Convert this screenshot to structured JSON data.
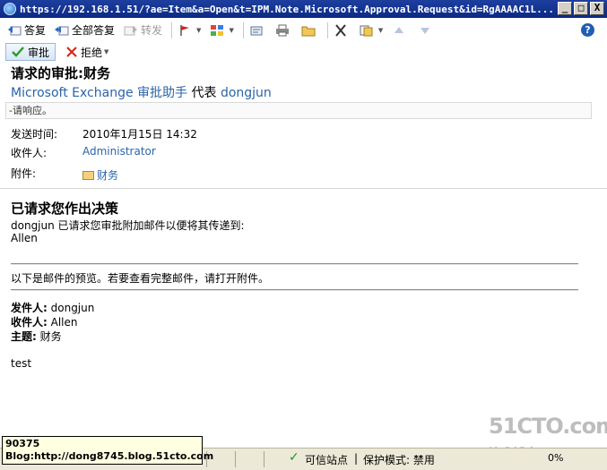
{
  "window": {
    "title": "https://192.168.1.51/?ae=Item&a=Open&t=IPM.Note.Microsoft.Approval.Request&id=RgAAAAC1L...",
    "buttons": [
      "_",
      "□",
      "X"
    ]
  },
  "toolbar": {
    "reply_label": "答复",
    "reply_all_label": "全部答复",
    "forward_label": "转发",
    "help_label": "?"
  },
  "actions": {
    "approve_label": "审批",
    "reject_label": "拒绝"
  },
  "message": {
    "subject": "请求的审批:财务",
    "sender_app": "Microsoft Exchange 审批助手",
    "on_behalf_word": "代表",
    "sender_user": "dongjun",
    "respond_prompt": "-请响应。",
    "headers": {
      "sent_label": "发送时间:",
      "sent_value": "2010年1月15日 14:32",
      "to_label": "收件人:",
      "to_value": "Administrator",
      "attachment_label": "附件:",
      "attachment_value": "财务"
    }
  },
  "body": {
    "heading": "已请求您作出决策",
    "line1": "dongjun 已请求您审批附加邮件以便将其传递到:",
    "line2": "Allen",
    "preview_note": "以下是邮件的预览。若要查看完整邮件，请打开附件。",
    "from_label": "发件人:",
    "from_value": " dongjun",
    "to_label": "收件人:",
    "to_value": " Allen",
    "subject_label": "主题:",
    "subject_value": " 财务",
    "content": "test"
  },
  "statusbar": {
    "zone": "可信站点",
    "separator": "|",
    "protected_mode": "保护模式: 禁用",
    "zoom": "0%"
  },
  "tooltip": {
    "line1": "90375",
    "line2": "Blog:http://dong8745.blog.51cto.com"
  },
  "watermark": {
    "brand": "51CTO.com",
    "tagline": "技术博客 Blog"
  },
  "colors": {
    "titlebar": "#0b2a86",
    "link": "#2a64a8",
    "statusbar": "#ece9d8"
  }
}
